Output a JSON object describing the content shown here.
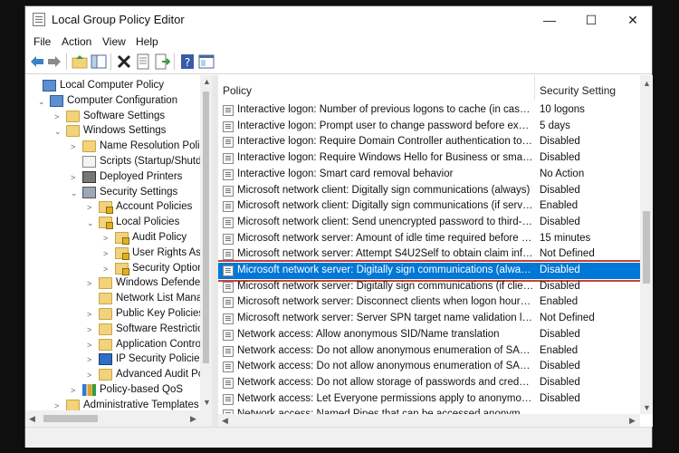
{
  "window": {
    "title": "Local Group Policy Editor",
    "controls": {
      "minimize": "—",
      "maximize": "☐",
      "close": "✕"
    }
  },
  "menu": [
    "File",
    "Action",
    "View",
    "Help"
  ],
  "toolbar_icons": [
    "back-arrow-icon",
    "forward-arrow-icon",
    "up-folder-icon",
    "show-hide-tree-icon",
    "delete-icon",
    "properties-icon",
    "export-list-icon",
    "help-icon",
    "console-icon"
  ],
  "tree": [
    {
      "label": "Local Computer Policy",
      "icon": "computer-icon",
      "expander": ""
    },
    {
      "label": "Computer Configuration",
      "icon": "computer-icon",
      "expander": "⌄"
    },
    {
      "label": "Software Settings",
      "icon": "folder-icon",
      "expander": ">"
    },
    {
      "label": "Windows Settings",
      "icon": "folder-icon",
      "expander": "⌄"
    },
    {
      "label": "Name Resolution Policy",
      "icon": "folder-icon",
      "expander": ">"
    },
    {
      "label": "Scripts (Startup/Shutdov",
      "icon": "scripts-icon",
      "expander": ""
    },
    {
      "label": "Deployed Printers",
      "icon": "printer-icon",
      "expander": ">"
    },
    {
      "label": "Security Settings",
      "icon": "security-icon",
      "expander": "⌄"
    },
    {
      "label": "Account Policies",
      "icon": "folder-lock-icon",
      "expander": ">"
    },
    {
      "label": "Local Policies",
      "icon": "folder-lock-icon",
      "expander": "⌄"
    },
    {
      "label": "Audit Policy",
      "icon": "folder-lock-icon",
      "expander": ">"
    },
    {
      "label": "User Rights Assic",
      "icon": "folder-lock-icon",
      "expander": ">"
    },
    {
      "label": "Security Options",
      "icon": "folder-lock-icon",
      "expander": ">"
    },
    {
      "label": "Windows Defender F",
      "icon": "folder-icon",
      "expander": ">"
    },
    {
      "label": "Network List Manag",
      "icon": "folder-icon",
      "expander": ""
    },
    {
      "label": "Public Key Policies",
      "icon": "folder-icon",
      "expander": ">"
    },
    {
      "label": "Software Restriction",
      "icon": "folder-icon",
      "expander": ">"
    },
    {
      "label": "Application Control",
      "icon": "folder-icon",
      "expander": ">"
    },
    {
      "label": "IP Security Policies o",
      "icon": "ip-security-icon",
      "expander": ">"
    },
    {
      "label": "Advanced Audit Poli",
      "icon": "folder-icon",
      "expander": ">"
    },
    {
      "label": "Policy-based QoS",
      "icon": "chart-bars-icon",
      "expander": ">"
    },
    {
      "label": "Administrative Templates",
      "icon": "folder-icon",
      "expander": ">"
    }
  ],
  "columns": {
    "policy": "Policy",
    "setting": "Security Setting"
  },
  "policies": [
    {
      "name": "Interactive logon: Number of previous logons to cache (in case do...",
      "setting": "10 logons"
    },
    {
      "name": "Interactive logon: Prompt user to change password before expirati...",
      "setting": "5 days"
    },
    {
      "name": "Interactive logon: Require Domain Controller authentication to un...",
      "setting": "Disabled"
    },
    {
      "name": "Interactive logon: Require Windows Hello for Business or smart card",
      "setting": "Disabled"
    },
    {
      "name": "Interactive logon: Smart card removal behavior",
      "setting": "No Action"
    },
    {
      "name": "Microsoft network client: Digitally sign communications (always)",
      "setting": "Disabled"
    },
    {
      "name": "Microsoft network client: Digitally sign communications (if server a...",
      "setting": "Enabled"
    },
    {
      "name": "Microsoft network client: Send unencrypted password to third-par...",
      "setting": "Disabled"
    },
    {
      "name": "Microsoft network server: Amount of idle time required before sus...",
      "setting": "15 minutes"
    },
    {
      "name": "Microsoft network server: Attempt S4U2Self to obtain claim inform...",
      "setting": "Not Defined"
    },
    {
      "name": "Microsoft network server: Digitally sign communications (always)",
      "setting": "Disabled"
    },
    {
      "name": "Microsoft network server: Digitally sign communications (if client a...",
      "setting": "Disabled"
    },
    {
      "name": "Microsoft network server: Disconnect clients when logon hours ex...",
      "setting": "Enabled"
    },
    {
      "name": "Microsoft network server: Server SPN target name validation level",
      "setting": "Not Defined"
    },
    {
      "name": "Network access: Allow anonymous SID/Name translation",
      "setting": "Disabled"
    },
    {
      "name": "Network access: Do not allow anonymous enumeration of SAM ac...",
      "setting": "Enabled"
    },
    {
      "name": "Network access: Do not allow anonymous enumeration of SAM ac...",
      "setting": "Disabled"
    },
    {
      "name": "Network access: Do not allow storage of passwords and credential...",
      "setting": "Disabled"
    },
    {
      "name": "Network access: Let Everyone permissions apply to anonymous us...",
      "setting": "Disabled"
    },
    {
      "name": "Network access: Named Pipes that can be accessed anonymously",
      "setting": ""
    }
  ],
  "colors": {
    "selection": "#0078d7",
    "highlight_outline": "#c8413a"
  }
}
